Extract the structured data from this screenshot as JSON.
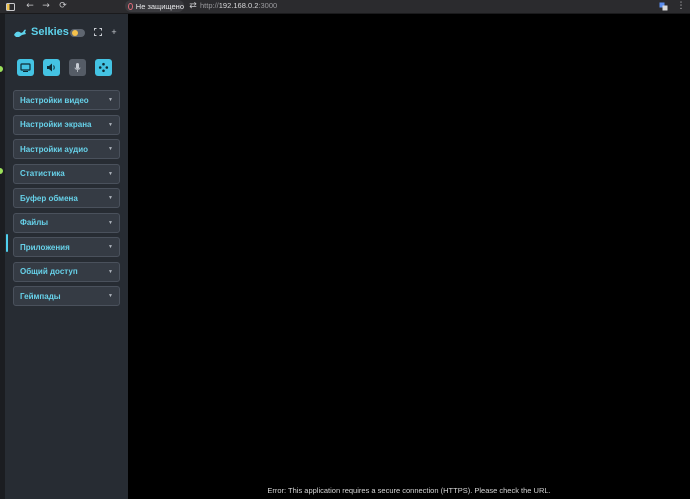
{
  "browser": {
    "security_label": "Не защищено",
    "url_scheme": "http://",
    "url_host": "192.168.0.2",
    "url_port": ":3000",
    "icons": [
      "sidebar-toggle-icon",
      "back-icon",
      "forward-icon",
      "reload-icon",
      "site-info-icon",
      "translate-icon",
      "more-icon"
    ]
  },
  "sidebar": {
    "app_name": "Selkies",
    "theme_toggle_icon": "moon-sun-icon",
    "header_icons": [
      "fullscreen-icon",
      "add-icon"
    ],
    "modes": [
      {
        "name": "display-mode",
        "icon": "monitor-icon",
        "active": true
      },
      {
        "name": "audio-mode",
        "icon": "speaker-icon",
        "active": true
      },
      {
        "name": "microphone-mode",
        "icon": "microphone-icon",
        "active": false
      },
      {
        "name": "gamepad-mode",
        "icon": "gamepad-icon",
        "active": true
      }
    ],
    "menu": [
      {
        "label": "Настройки видео"
      },
      {
        "label": "Настройки экрана"
      },
      {
        "label": "Настройки аудио"
      },
      {
        "label": "Статистика"
      },
      {
        "label": "Буфер обмена"
      },
      {
        "label": "Файлы"
      },
      {
        "label": "Приложения"
      },
      {
        "label": "Общий доступ"
      },
      {
        "label": "Геймпады"
      }
    ]
  },
  "status_message": "Error: This application requires a secure connection (HTTPS). Please check the URL.",
  "colors": {
    "accent": "#5ed3ec",
    "sidebar_bg": "#272c33",
    "menu_bg": "#353b44",
    "stream_bg": "#000000"
  }
}
